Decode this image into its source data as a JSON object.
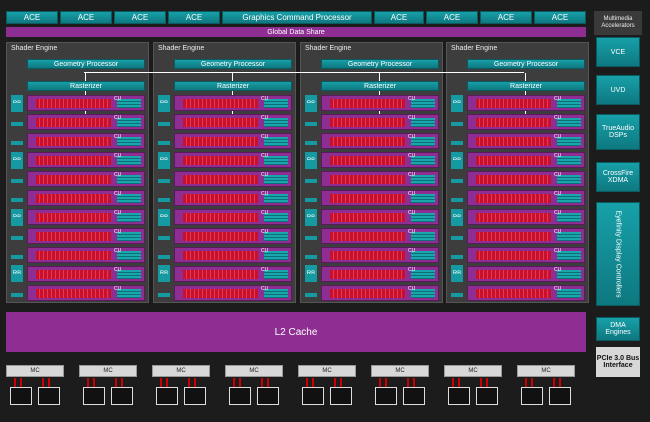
{
  "top_bar": {
    "ace_labels": [
      "ACE",
      "ACE",
      "ACE",
      "ACE",
      "ACE",
      "ACE",
      "ACE",
      "ACE"
    ],
    "gcp_label": "Graphics Command Processor",
    "global_data_share": "Global Data Share"
  },
  "shader_engines": [
    {
      "title": "Shader Engine",
      "geometry": "Geometry Processor",
      "rasterizer": "Rasterizer"
    },
    {
      "title": "Shader Engine",
      "geometry": "Geometry Processor",
      "rasterizer": "Rasterizer"
    },
    {
      "title": "Shader Engine",
      "geometry": "Geometry Processor",
      "rasterizer": "Rasterizer"
    },
    {
      "title": "Shader Engine",
      "geometry": "Geometry Processor",
      "rasterizer": "Rasterizer"
    }
  ],
  "cu_label": "CU",
  "rb_label": "RB",
  "l2_cache": "L2 Cache",
  "mc_label": "MC",
  "right_panel": {
    "multimedia": "Multimedia Accelerators",
    "vce": "VCE",
    "uvd": "UVD",
    "trueaudio": "TrueAudio DSPs",
    "crossfire": "CrossFire XDMA",
    "eyefinity": "Eyefinity Display Controllers",
    "dma": "DMA Engines",
    "pcie": "PCIe 3.0 Bus Interface"
  },
  "colors": {
    "teal": "#169aa2",
    "purple": "#8e2d92",
    "red": "#c8102e",
    "background": "#1c1c1c"
  }
}
